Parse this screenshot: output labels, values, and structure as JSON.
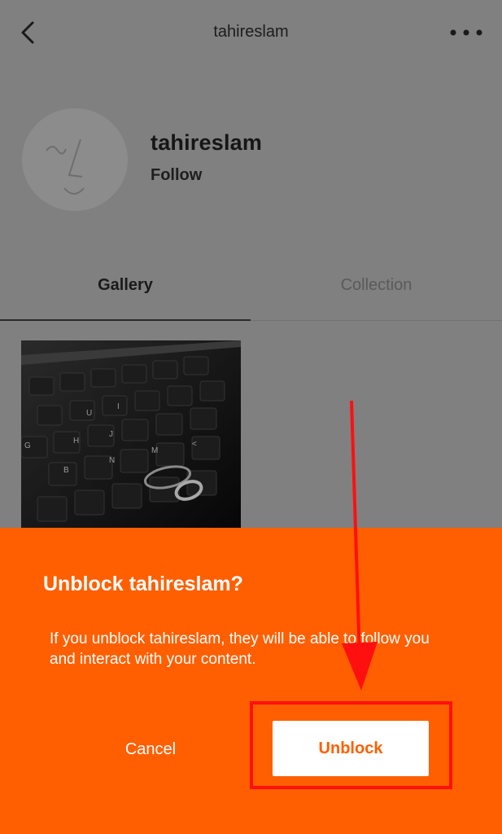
{
  "header": {
    "title": "tahireslam",
    "back_icon": "chevron-left-icon",
    "more_icon": "more-horizontal-icon"
  },
  "profile": {
    "username": "tahireslam",
    "follow_label": "Follow",
    "avatar_icon": "face-doodle-icon"
  },
  "tabs": [
    {
      "label": "Gallery",
      "active": true
    },
    {
      "label": "Collection",
      "active": false
    }
  ],
  "gallery": {
    "items": [
      {
        "description": "keyboard-with-ring-photo"
      }
    ]
  },
  "dialog": {
    "title": "Unblock tahireslam?",
    "body": "If you unblock tahireslam, they will be able to follow you and interact with your content.",
    "cancel_label": "Cancel",
    "confirm_label": "Unblock"
  },
  "colors": {
    "overlay_gray": "#808080",
    "accent": "#ff5f00",
    "annotation": "#ff1010"
  }
}
